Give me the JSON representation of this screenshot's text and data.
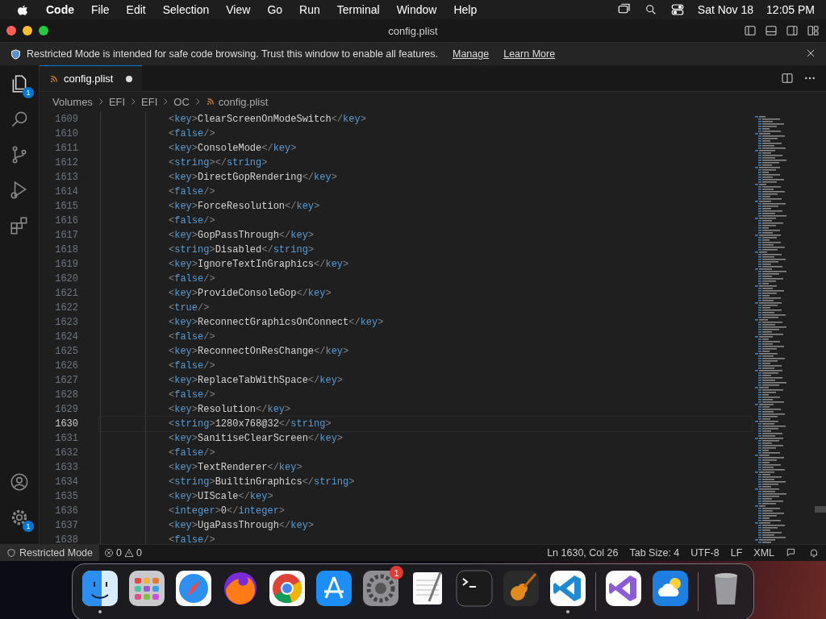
{
  "menubar": {
    "app": "Code",
    "menus": [
      "File",
      "Edit",
      "Selection",
      "View",
      "Go",
      "Run",
      "Terminal",
      "Window",
      "Help"
    ],
    "date": "Sat Nov 18",
    "time": "12:05 PM"
  },
  "window": {
    "title": "config.plist"
  },
  "banner": {
    "message": "Restricted Mode is intended for safe code browsing. Trust this window to enable all features.",
    "links": [
      "Manage",
      "Learn More"
    ]
  },
  "activity_bar": {
    "top": [
      {
        "kind": "explorer",
        "badge": "1",
        "selected": true
      },
      {
        "kind": "search",
        "selected": false
      },
      {
        "kind": "source-control",
        "selected": false
      },
      {
        "kind": "run",
        "selected": false
      },
      {
        "kind": "extensions",
        "selected": false
      }
    ],
    "bottom": [
      {
        "kind": "account"
      },
      {
        "kind": "settings",
        "badge": "1"
      }
    ]
  },
  "tabs": [
    {
      "label": "config.plist",
      "selected": true,
      "modified": true
    }
  ],
  "breadcrumbs": [
    "Volumes",
    "EFI",
    "EFI",
    "OC",
    "config.plist"
  ],
  "editor": {
    "lines": [
      {
        "number": "1609",
        "code": "<key>ClearScreenOnModeSwitch</key>",
        "current": false
      },
      {
        "number": "1610",
        "code": "<false/>",
        "current": false
      },
      {
        "number": "1611",
        "code": "<key>ConsoleMode</key>",
        "current": false
      },
      {
        "number": "1612",
        "code": "<string></string>",
        "current": false
      },
      {
        "number": "1613",
        "code": "<key>DirectGopRendering</key>",
        "current": false
      },
      {
        "number": "1614",
        "code": "<false/>",
        "current": false
      },
      {
        "number": "1615",
        "code": "<key>ForceResolution</key>",
        "current": false
      },
      {
        "number": "1616",
        "code": "<false/>",
        "current": false
      },
      {
        "number": "1617",
        "code": "<key>GopPassThrough</key>",
        "current": false
      },
      {
        "number": "1618",
        "code": "<string>Disabled</string>",
        "current": false
      },
      {
        "number": "1619",
        "code": "<key>IgnoreTextInGraphics</key>",
        "current": false
      },
      {
        "number": "1620",
        "code": "<false/>",
        "current": false
      },
      {
        "number": "1621",
        "code": "<key>ProvideConsoleGop</key>",
        "current": false
      },
      {
        "number": "1622",
        "code": "<true/>",
        "current": false
      },
      {
        "number": "1623",
        "code": "<key>ReconnectGraphicsOnConnect</key>",
        "current": false
      },
      {
        "number": "1624",
        "code": "<false/>",
        "current": false
      },
      {
        "number": "1625",
        "code": "<key>ReconnectOnResChange</key>",
        "current": false
      },
      {
        "number": "1626",
        "code": "<false/>",
        "current": false
      },
      {
        "number": "1627",
        "code": "<key>ReplaceTabWithSpace</key>",
        "current": false
      },
      {
        "number": "1628",
        "code": "<false/>",
        "current": false
      },
      {
        "number": "1629",
        "code": "<key>Resolution</key>",
        "current": false
      },
      {
        "number": "1630",
        "code": "<string>1280x768@32</string>",
        "current": true
      },
      {
        "number": "1631",
        "code": "<key>SanitiseClearScreen</key>",
        "current": false
      },
      {
        "number": "1632",
        "code": "<false/>",
        "current": false
      },
      {
        "number": "1633",
        "code": "<key>TextRenderer</key>",
        "current": false
      },
      {
        "number": "1634",
        "code": "<string>BuiltinGraphics</string>",
        "current": false
      },
      {
        "number": "1635",
        "code": "<key>UIScale</key>",
        "current": false
      },
      {
        "number": "1636",
        "code": "<integer>0</integer>",
        "current": false
      },
      {
        "number": "1637",
        "code": "<key>UgaPassThrough</key>",
        "current": false
      },
      {
        "number": "1638",
        "code": "<false/>",
        "current": false
      }
    ]
  },
  "status_bar": {
    "restricted": "Restricted Mode",
    "errors": "0",
    "warnings": "0",
    "items": [
      "Ln 1630, Col 26",
      "Tab Size: 4",
      "UTF-8",
      "LF",
      "XML"
    ]
  },
  "dock": [
    {
      "kind": "finder",
      "running": true
    },
    {
      "kind": "launchpad",
      "running": false
    },
    {
      "kind": "safari",
      "running": false
    },
    {
      "kind": "firefox",
      "running": false
    },
    {
      "kind": "chrome",
      "running": false
    },
    {
      "kind": "appstore",
      "running": false
    },
    {
      "kind": "settings",
      "running": false,
      "badge": "1"
    },
    {
      "kind": "textedit",
      "running": false
    },
    {
      "kind": "terminal",
      "running": false
    },
    {
      "kind": "garageband",
      "running": false
    },
    {
      "kind": "vscode",
      "running": true
    },
    {
      "kind": "separator"
    },
    {
      "kind": "visualstudio",
      "running": false
    },
    {
      "kind": "weather",
      "running": false
    },
    {
      "kind": "separator"
    },
    {
      "kind": "trash",
      "running": false
    }
  ]
}
